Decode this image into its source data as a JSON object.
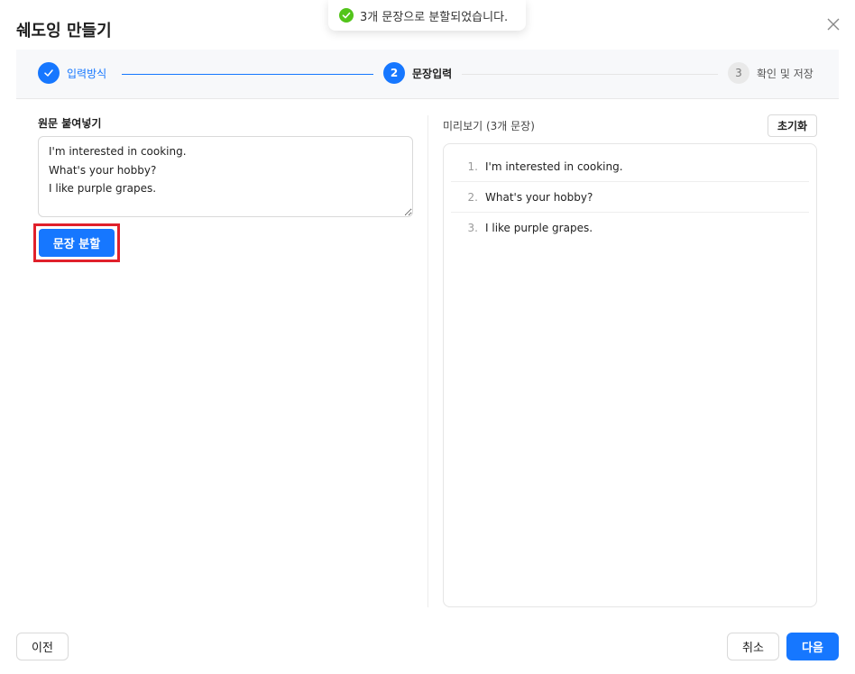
{
  "modal": {
    "title": "쉐도잉 만들기"
  },
  "toast": {
    "message": "3개 문장으로 분할되었습니다."
  },
  "steps": [
    {
      "number": "1",
      "label": "입력방식",
      "state": "done"
    },
    {
      "number": "2",
      "label": "문장입력",
      "state": "active"
    },
    {
      "number": "3",
      "label": "확인 및 저장",
      "state": "pending"
    }
  ],
  "input": {
    "label": "원문 붙여넣기",
    "value": "I'm interested in cooking.\nWhat's your hobby?\nI like purple grapes."
  },
  "split_button": {
    "label": "문장 분할"
  },
  "preview": {
    "label": "미리보기 (3개 문장)",
    "reset_label": "초기화",
    "items": [
      {
        "num": "1.",
        "text": "I'm interested in cooking."
      },
      {
        "num": "2.",
        "text": "What's your hobby?"
      },
      {
        "num": "3.",
        "text": "I like purple grapes."
      }
    ]
  },
  "footer": {
    "prev_label": "이전",
    "cancel_label": "취소",
    "next_label": "다음"
  },
  "colors": {
    "primary": "#1677ff",
    "highlight": "#e0202b",
    "success": "#52c41a"
  }
}
